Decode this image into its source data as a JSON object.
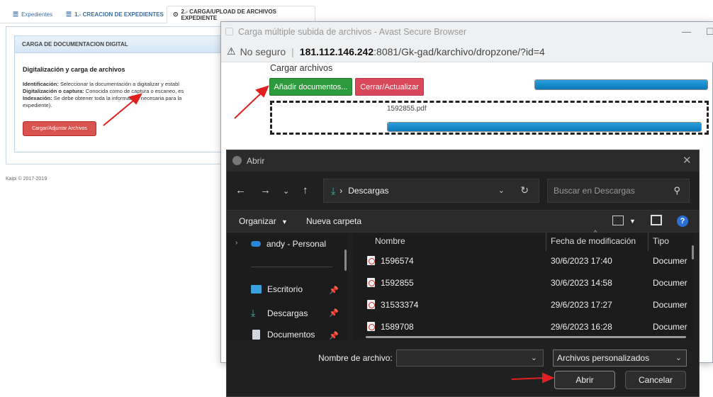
{
  "app": {
    "tabs": [
      {
        "icon": "list-icon",
        "label": "Expedientes"
      },
      {
        "icon": "list-icon",
        "label": "1.- CREACION DE EXPEDIENTES"
      },
      {
        "icon": "circle-icon",
        "label": "2.- CARGA/UPLOAD DE ARCHIVOS EXPEDIENTE"
      }
    ],
    "panel_title": "CARGA DE DOCUMENTACION DIGITAL",
    "section_title": "Digitalización y carga de archivos",
    "lines": [
      {
        "term": "Identificación:",
        "text": " Seleccionar la documentación a digitalizar y establ"
      },
      {
        "term": "Digitalización o captura:",
        "text": " Conocida como de captura o escaneo, es"
      },
      {
        "term": "Indexación:",
        "text": " Se debe obtener toda la información necesaria para la"
      },
      {
        "term": "",
        "text": "expediente)."
      }
    ],
    "upload_button": "Cargar/Adjuntar Archivos",
    "footer": "Kaipi © 2017-2019"
  },
  "browser": {
    "title": "Carga múltiple subida de archivos - Avast Secure Browser",
    "security_label": "No seguro",
    "url_host": "181.112.146.242",
    "url_rest": ":8081/Gk-gad/karchivo/dropzone/?id=4",
    "upload_title": "Cargar archivos",
    "add_button": "Añadir documentos...",
    "refresh_button": "Cerrar/Actualizar",
    "total_progress": 1.0,
    "file_name": "1592855.pdf",
    "file_progress": 1.0
  },
  "dialog": {
    "title": "Abrir",
    "path": "Descargas",
    "search_placeholder": "Buscar en Descargas",
    "organize": "Organizar",
    "new_folder": "Nueva carpeta",
    "help": "?",
    "nav": [
      {
        "icon": "onedrive-icon",
        "label": "andy - Personal"
      },
      {
        "icon": "desktop-folder-icon",
        "label": "Escritorio"
      },
      {
        "icon": "download-icon",
        "label": "Descargas"
      },
      {
        "icon": "documents-icon",
        "label": "Documentos"
      }
    ],
    "columns": [
      "Nombre",
      "Fecha de modificación",
      "Tipo"
    ],
    "files": [
      {
        "name": "1596574",
        "date": "30/6/2023 17:40",
        "type": "Documer"
      },
      {
        "name": "1592855",
        "date": "30/6/2023 14:58",
        "type": "Documer"
      },
      {
        "name": "31533374",
        "date": "29/6/2023 17:27",
        "type": "Documer"
      },
      {
        "name": "1589708",
        "date": "29/6/2023 16:28",
        "type": "Documer"
      }
    ],
    "filename_label": "Nombre de archivo:",
    "filename_value": "",
    "filetype": "Archivos personalizados",
    "open_button": "Abrir",
    "cancel_button": "Cancelar"
  },
  "colors": {
    "annotation_arrow": "#e02020",
    "progress": "#0a86c8",
    "green": "#2e9a3e",
    "red": "#d9475a"
  }
}
